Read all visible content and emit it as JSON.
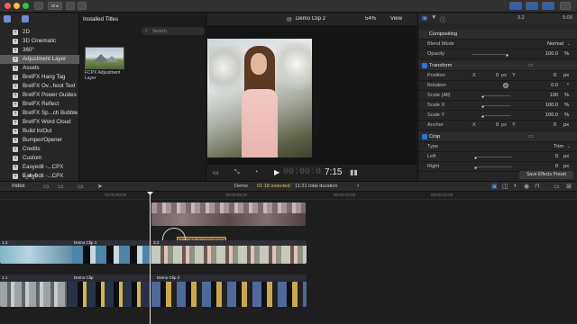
{
  "window": {
    "title_badge": "One"
  },
  "browser": {
    "category_title": "Installed Titles",
    "search_placeholder": "Search",
    "sidebar_items": [
      {
        "label": "2D"
      },
      {
        "label": "3D Cinematic"
      },
      {
        "label": "360°"
      },
      {
        "label": "Adjustment Layer",
        "selected": true
      },
      {
        "label": "Assets"
      },
      {
        "label": "BretFX Hang Tag"
      },
      {
        "label": "BretFX Ov...hoot Text"
      },
      {
        "label": "BretFX Power Guides"
      },
      {
        "label": "BretFX Reflect"
      },
      {
        "label": "BretFX Sp...ch Bubble"
      },
      {
        "label": "BretFX Word Cloud"
      },
      {
        "label": "Build In/Out"
      },
      {
        "label": "Bumper/Opener"
      },
      {
        "label": "Credits"
      },
      {
        "label": "Custom"
      },
      {
        "label": "Easyedit -...CPX v_4_0"
      },
      {
        "label": "Easyedit -...CPX v_4_4"
      }
    ],
    "thumbnail_label_line1": "FCPX Adjustment",
    "thumbnail_label_line2": "Layer"
  },
  "viewer": {
    "clip_title": "Demo Clip 2",
    "zoom": "54%",
    "view_label": "View",
    "timecode": "7:15"
  },
  "inspector": {
    "timecode_start": "3.2",
    "timecode_end": "5:00",
    "compositing": {
      "title": "Compositing",
      "blend_mode_label": "Blend Mode",
      "blend_mode_value": "Normal",
      "opacity_label": "Opacity",
      "opacity_value": "100.0",
      "opacity_unit": "%"
    },
    "transform": {
      "title": "Transform",
      "position_label": "Position",
      "position_x_axis": "X",
      "position_x": "0",
      "position_y_axis": "Y",
      "position_y": "0",
      "rotation_label": "Rotation",
      "rotation_value": "0.0",
      "scale_all_label": "Scale (All)",
      "scale_all_value": "100",
      "scale_x_label": "Scale X",
      "scale_x_value": "100.0",
      "scale_y_label": "Scale Y",
      "scale_y_value": "100.0",
      "anchor_label": "Anchor",
      "anchor_x_axis": "X",
      "anchor_x": "0",
      "anchor_y_axis": "Y",
      "anchor_y": "0"
    },
    "crop": {
      "title": "Crop",
      "type_label": "Type",
      "type_value": "Trim",
      "left_label": "Left",
      "left_value": "0",
      "right_label": "Right",
      "right_value": "0"
    },
    "units": {
      "px": "px",
      "pct": "%",
      "deg": "°"
    },
    "save_preset_label": "Save Effects Preset"
  },
  "timeline": {
    "index_label": "Index",
    "project_name": "Demo",
    "selected_duration": "01:18 selected",
    "total_duration": "11:21 total duration",
    "ruler_ticks": [
      "00:00:00:00",
      "00:00:05:00",
      "00:00:10:00",
      "00:00:15:00"
    ],
    "adjustment_clip_label": "FCPX Adjustment Layer",
    "clips": {
      "upper_left_num": "1.2",
      "upper_left_name": "Demo Clip 1",
      "upper_right_num": "3.2",
      "lower_left_num": "1.1",
      "lower_mid_name": "Demo Clip",
      "lower_right_name": "Demo Clip 2"
    }
  }
}
